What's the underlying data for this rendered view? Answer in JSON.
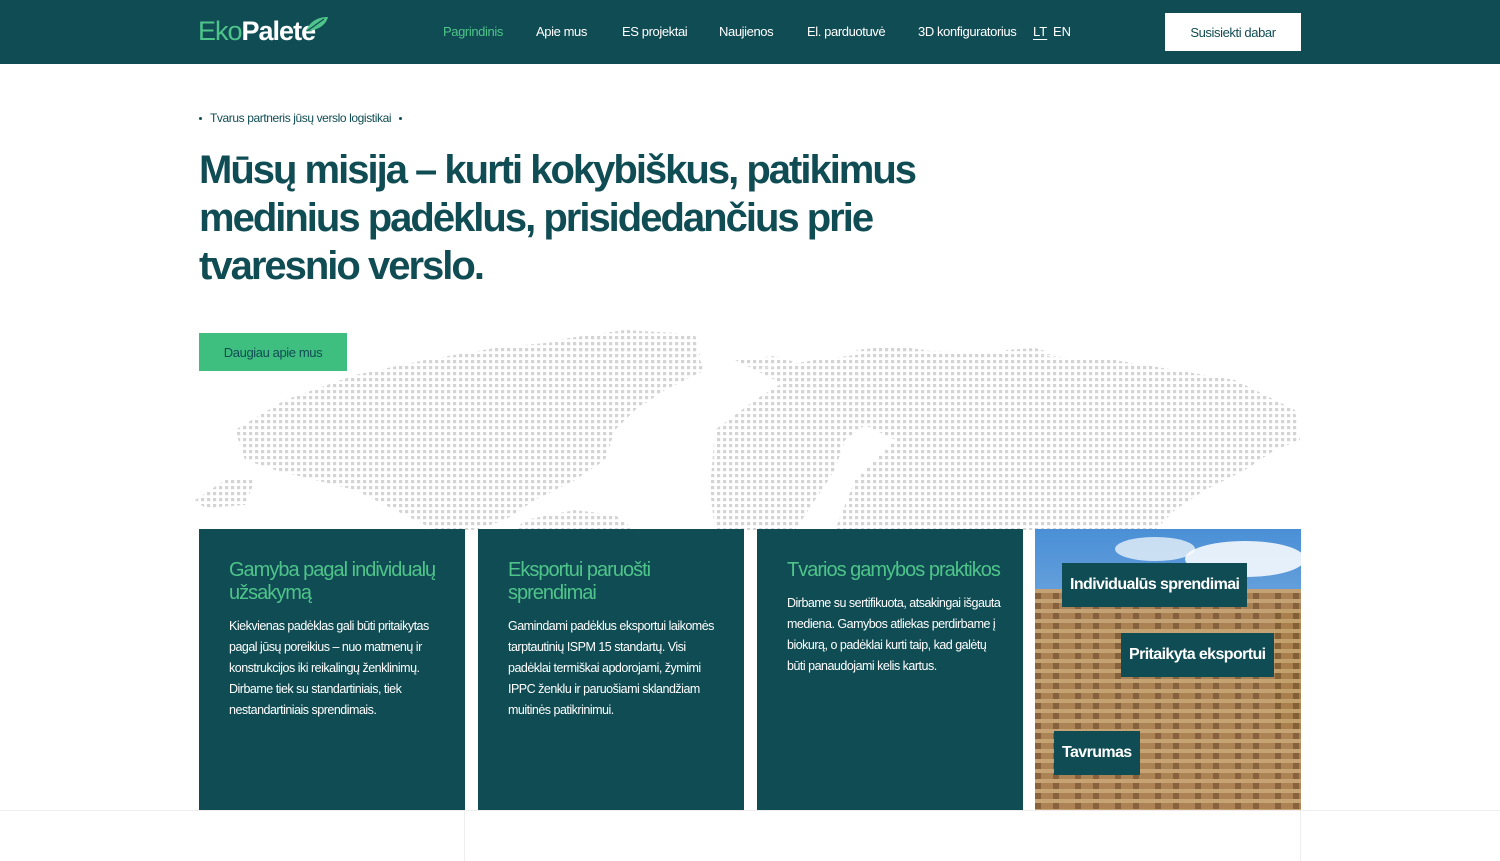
{
  "header": {
    "logo_part1": "Eko",
    "logo_part2": "Palete",
    "nav": [
      "Pagrindinis",
      "Apie mus",
      "ES projektai",
      "Naujienos",
      "El. parduotuvė",
      "3D konfiguratorius"
    ],
    "languages": [
      "LT",
      "EN"
    ],
    "cta_label": "Susisiekti dabar"
  },
  "hero": {
    "tagline": "Tvarus partneris jūsų verslo logistikai",
    "title": "Mūsų misija – kurti kokybiškus, patikimus medinius padėklus, prisidedančius prie tvaresnio verslo.",
    "button_label": "Daugiau apie mus"
  },
  "cards": [
    {
      "title": "Gamyba pagal individualų užsakymą",
      "text": "Kiekvienas padėklas gali būti pritaikytas pagal jūsų poreikius – nuo matmenų ir konstrukcijos iki reikalingų ženklinimų. Dirbame tiek su standartiniais, tiek nestandartiniais sprendimais."
    },
    {
      "title": "Eksportui paruošti sprendimai",
      "text": "Gamindami padėklus eksportui laikomės tarptautinių ISPM 15 standartų. Visi padėklai termiškai apdorojami, žymimi IPPC ženklu ir paruošiami sklandžiam muitinės patikrinimui."
    },
    {
      "title": "Tvarios gamybos praktikos",
      "text": "Dirbame su sertifikuota, atsakingai išgauta mediena. Gamybos atliekas perdirbame į biokurą, o padėklai kurti taip, kad galėtų būti panaudojami kelis kartus."
    }
  ],
  "photo_labels": [
    "Individualūs sprendimai",
    "Pritaikyta eksportui",
    "Tavrumas"
  ],
  "colors": {
    "primary": "#104c53",
    "accent": "#4fc48a",
    "button": "#3fbf7f"
  }
}
